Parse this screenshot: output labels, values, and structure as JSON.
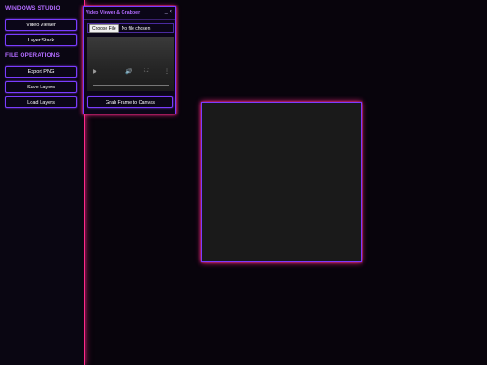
{
  "sidebar": {
    "app_title": "WINDOWS STUDIO",
    "buttons_top": [
      {
        "label": "Video Viewer"
      },
      {
        "label": "Layer Stack"
      }
    ],
    "file_ops_title": "FILE OPERATIONS",
    "buttons_file": [
      {
        "label": "Export PNG"
      },
      {
        "label": "Save Layers"
      },
      {
        "label": "Load Layers"
      }
    ]
  },
  "window": {
    "title": "Video Viewer & Grabber",
    "minimize": "_",
    "close": "×",
    "file_input": {
      "button_label": "Choose File",
      "status": "No file chosen"
    },
    "video_controls": {
      "play_icon": "▶",
      "volume_icon": "🔊",
      "fullscreen_icon": "⛶",
      "more_icon": "⋮"
    },
    "grab_button": "Grab Frame to Canvas"
  },
  "colors": {
    "accent": "#7a3cff",
    "glow": "#ff2a8a",
    "heading": "#b26bff"
  }
}
